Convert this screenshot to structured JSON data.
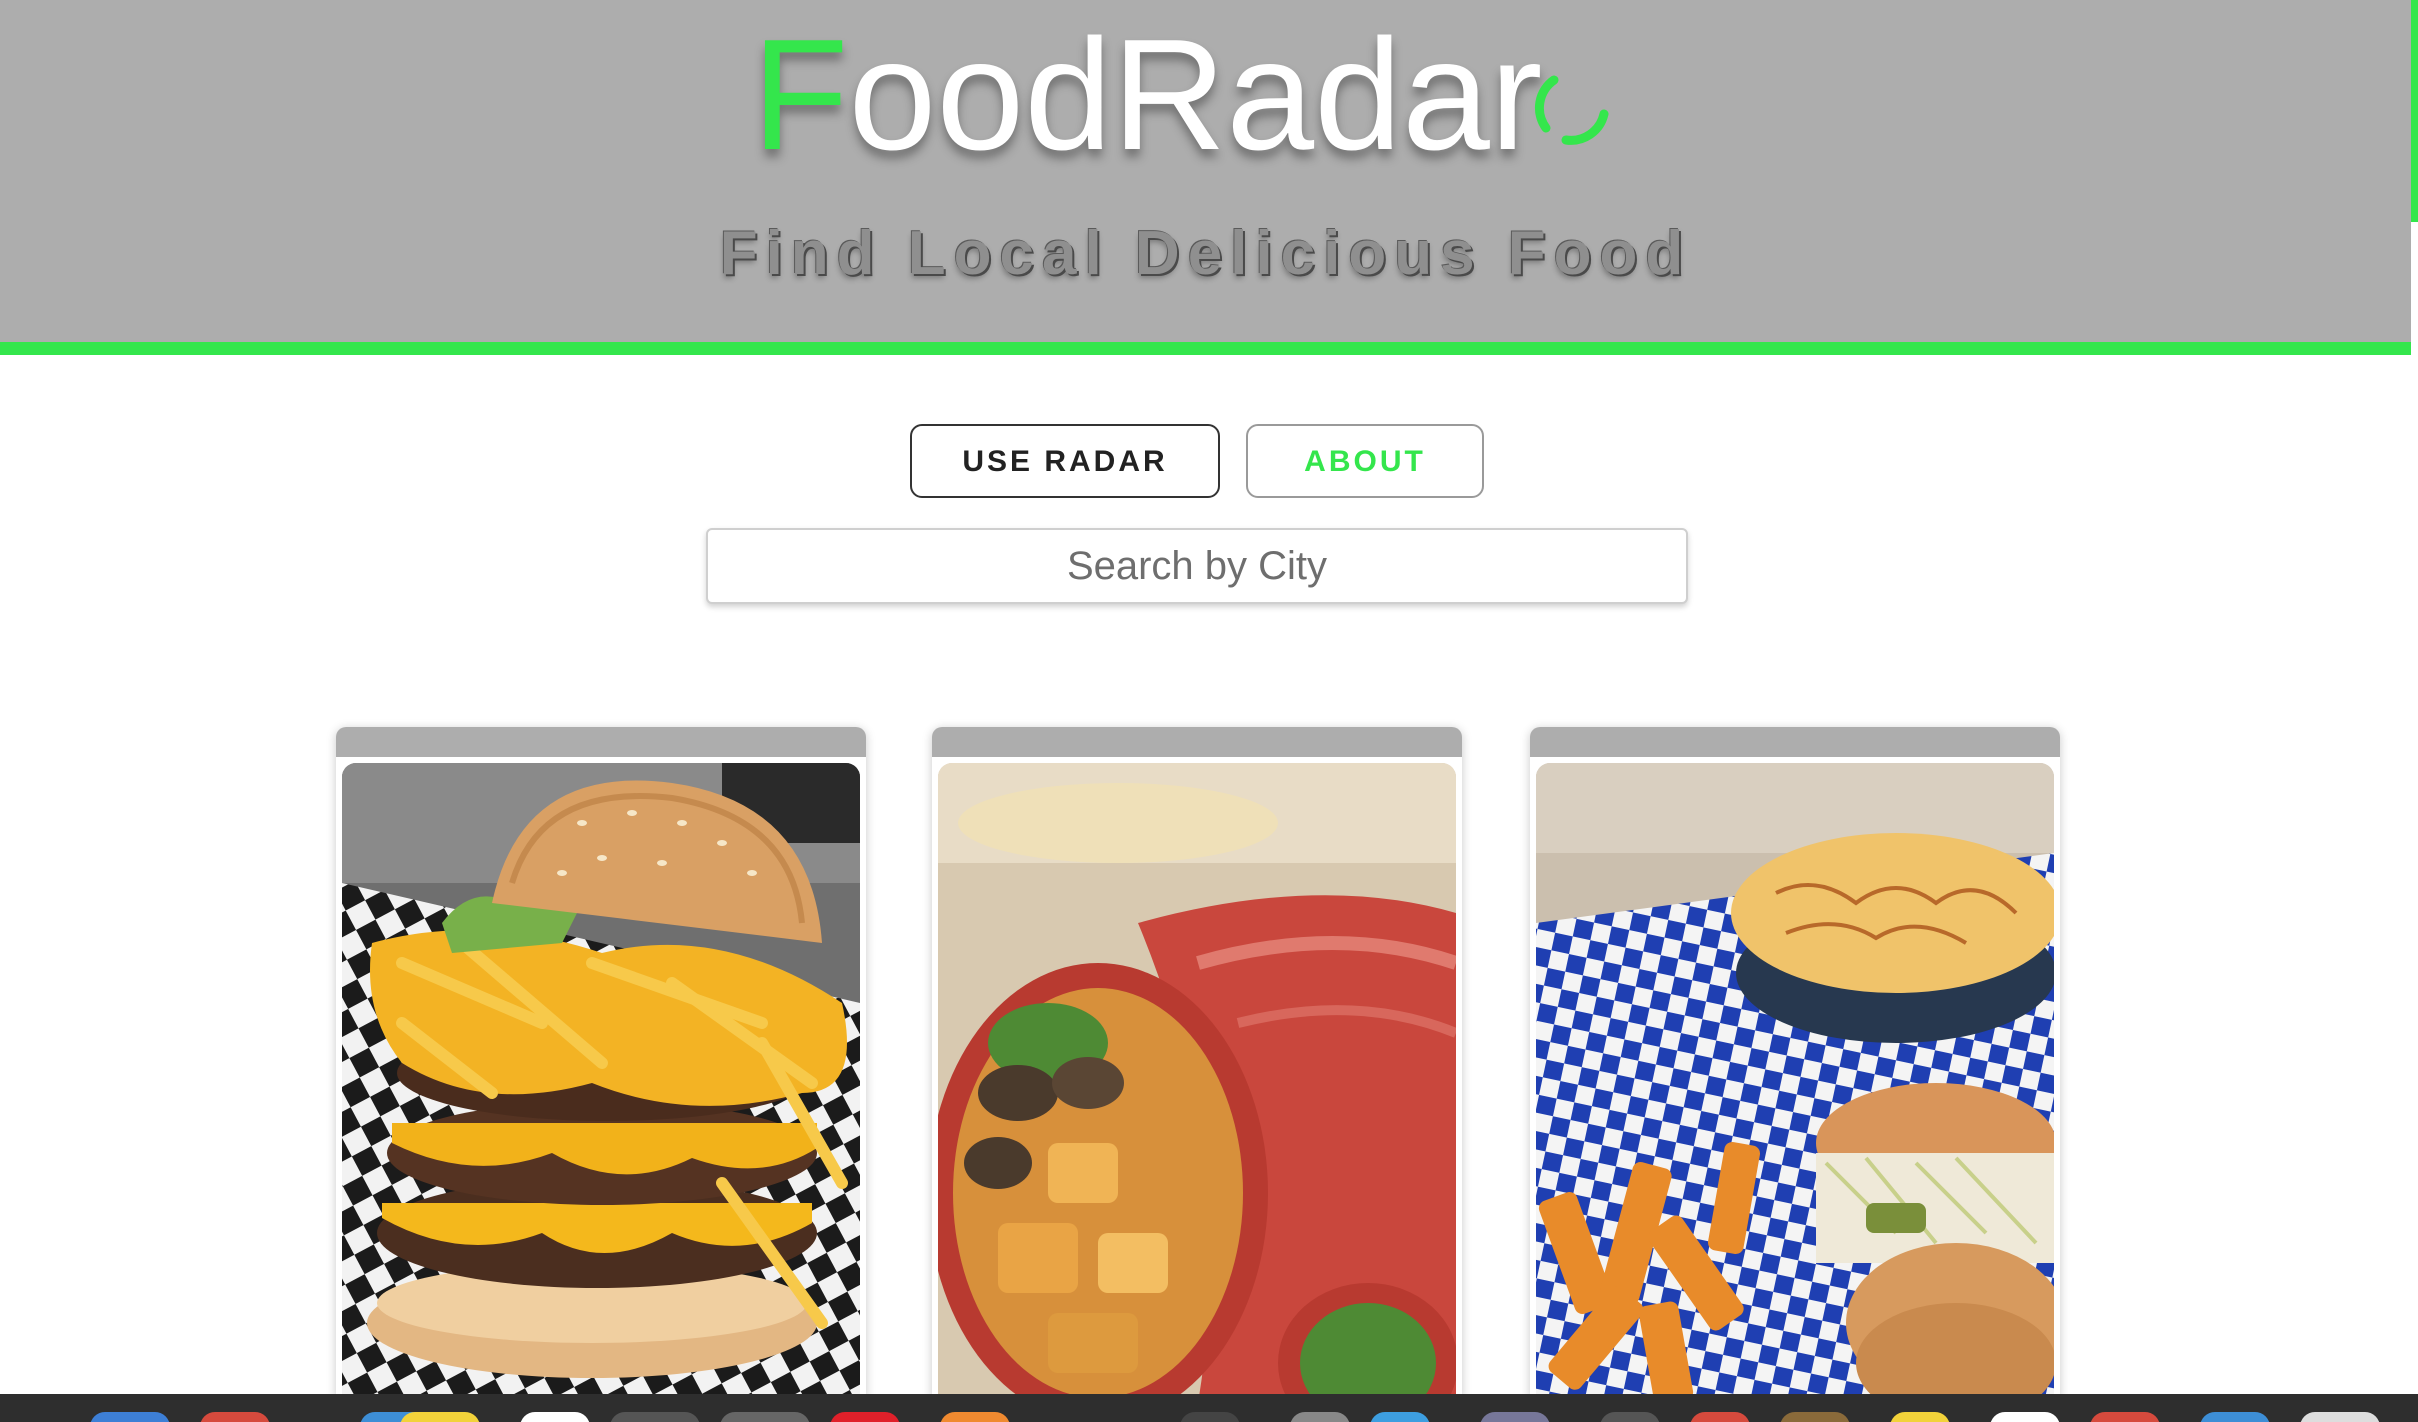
{
  "header": {
    "brand_first_letter": "F",
    "brand_rest": "oodRadar",
    "tagline": "Find Local Delicious Food",
    "accent_color": "#34e64c",
    "background_color": "#adadad"
  },
  "nav": {
    "use_radar_label": "USE RADAR",
    "about_label": "ABOUT"
  },
  "search": {
    "placeholder": "Search by City",
    "value": ""
  },
  "cards": [
    {
      "icon": "burger-photo"
    },
    {
      "icon": "wrap-photo"
    },
    {
      "icon": "burger-fries-photo"
    }
  ],
  "icons": {
    "radar": "radar-spinner-icon"
  }
}
